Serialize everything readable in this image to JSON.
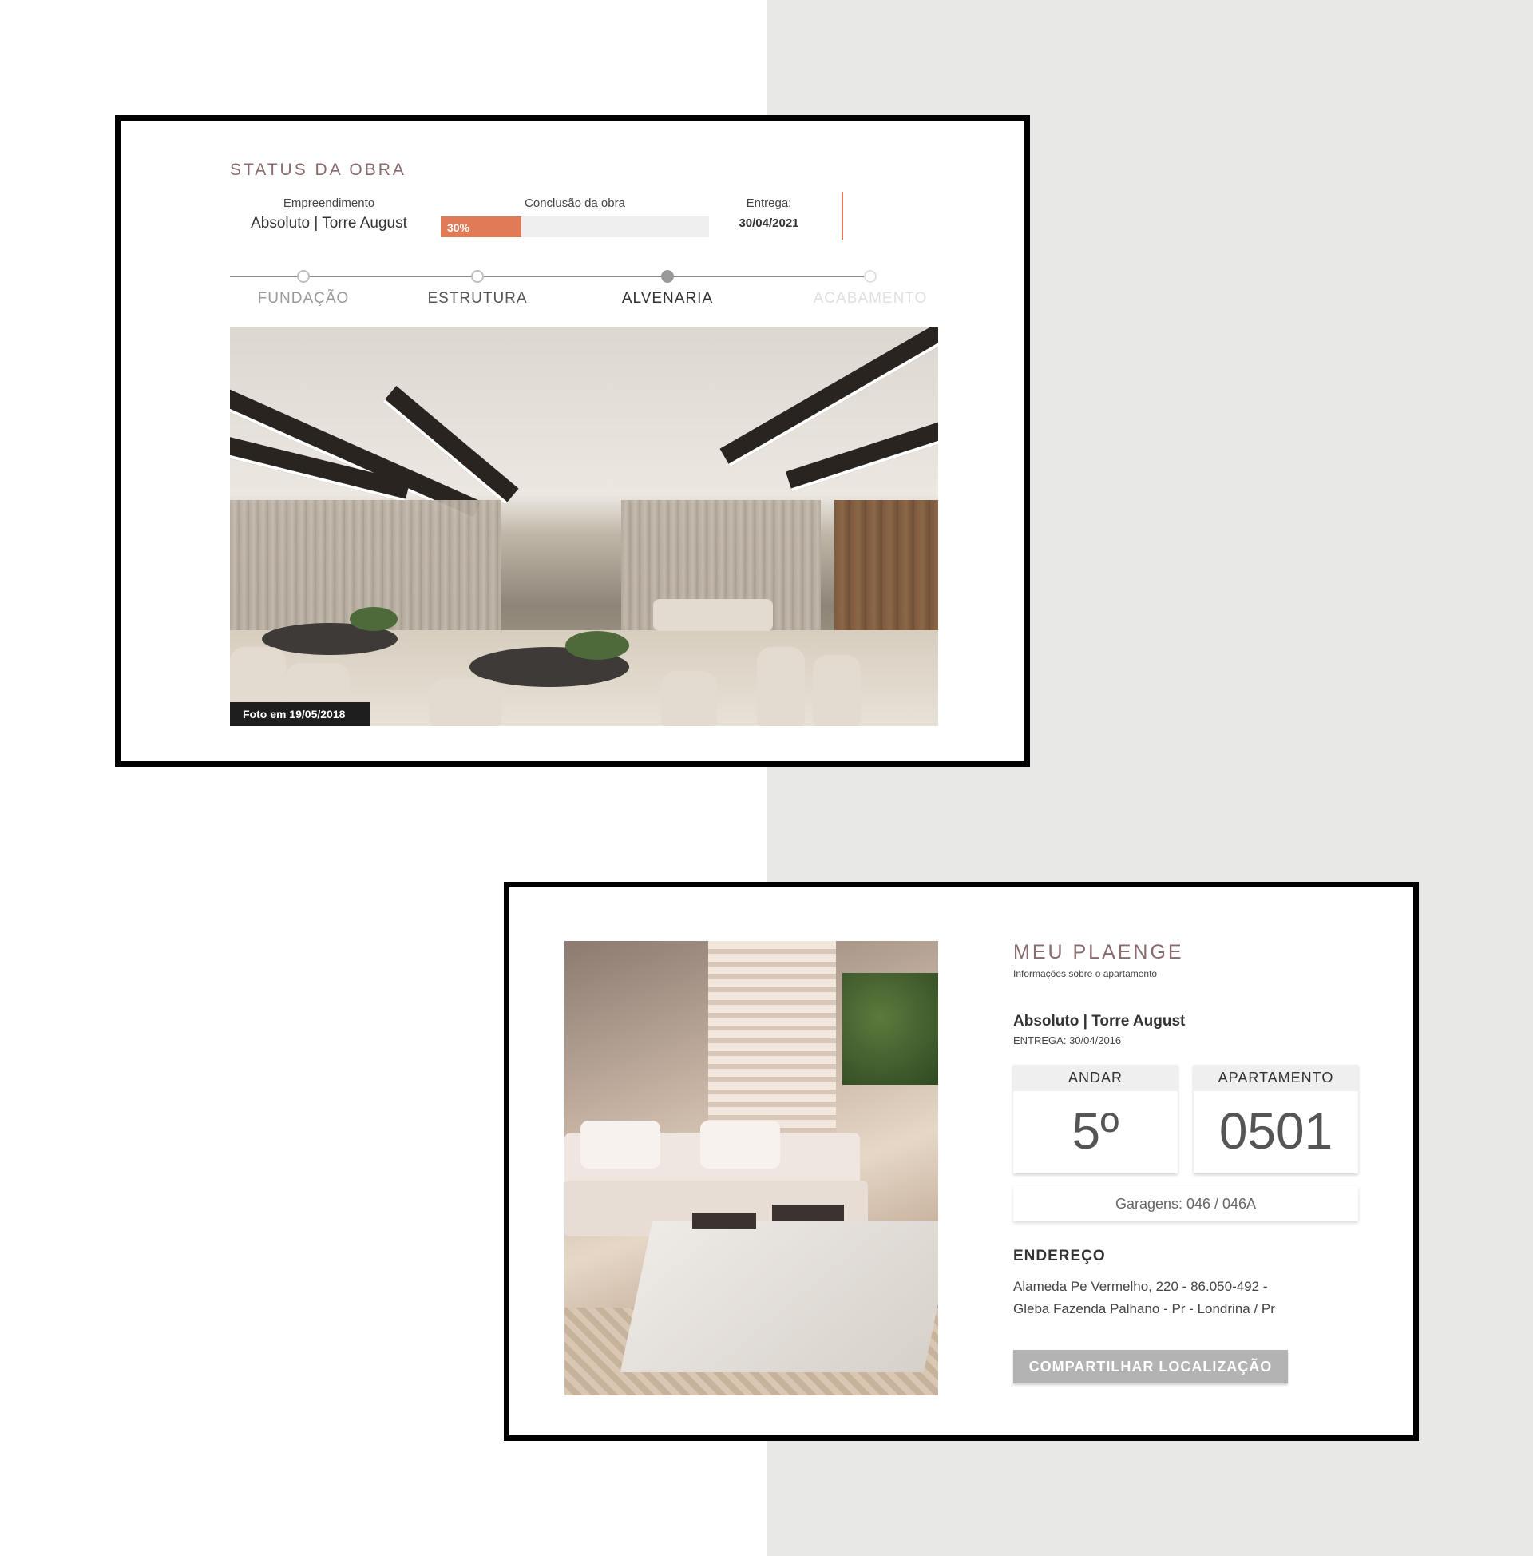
{
  "status_card": {
    "title": "STATUS DA OBRA",
    "empreendimento_label": "Empreendimento",
    "empreendimento_value": "Absoluto | Torre August",
    "conclusao_label": "Conclusão da obra",
    "conclusao_percent": 30,
    "conclusao_text": "30%",
    "entrega_label": "Entrega:",
    "entrega_value": "30/04/2021",
    "steps": [
      {
        "label": "FUNDAÇÃO",
        "state": "done"
      },
      {
        "label": "ESTRUTURA",
        "state": "done"
      },
      {
        "label": "ALVENARIA",
        "state": "active"
      },
      {
        "label": "ACABAMENTO",
        "state": "future"
      }
    ],
    "photo_caption": "Foto em 19/05/2018"
  },
  "plaenge_card": {
    "title": "MEU PLAENGE",
    "subtitle": "Informações sobre o apartamento",
    "project_name": "Absoluto | Torre August",
    "delivery": "ENTREGA: 30/04/2016",
    "andar_label": "ANDAR",
    "andar_value": "5º",
    "apartamento_label": "APARTAMENTO",
    "apartamento_value": "0501",
    "garagens": "Garagens: 046 / 046A",
    "endereco_title": "ENDEREÇO",
    "endereco_line1": "Alameda Pe Vermelho, 220 - 86.050-492 -",
    "endereco_line2": "Gleba Fazenda Palhano - Pr - Londrina / Pr",
    "share_button": "COMPARTILHAR LOCALIZAÇÃO"
  },
  "colors": {
    "accent": "#e07a57",
    "title_brown": "#8a6b6b",
    "panel_gray": "#e8e8e6"
  }
}
